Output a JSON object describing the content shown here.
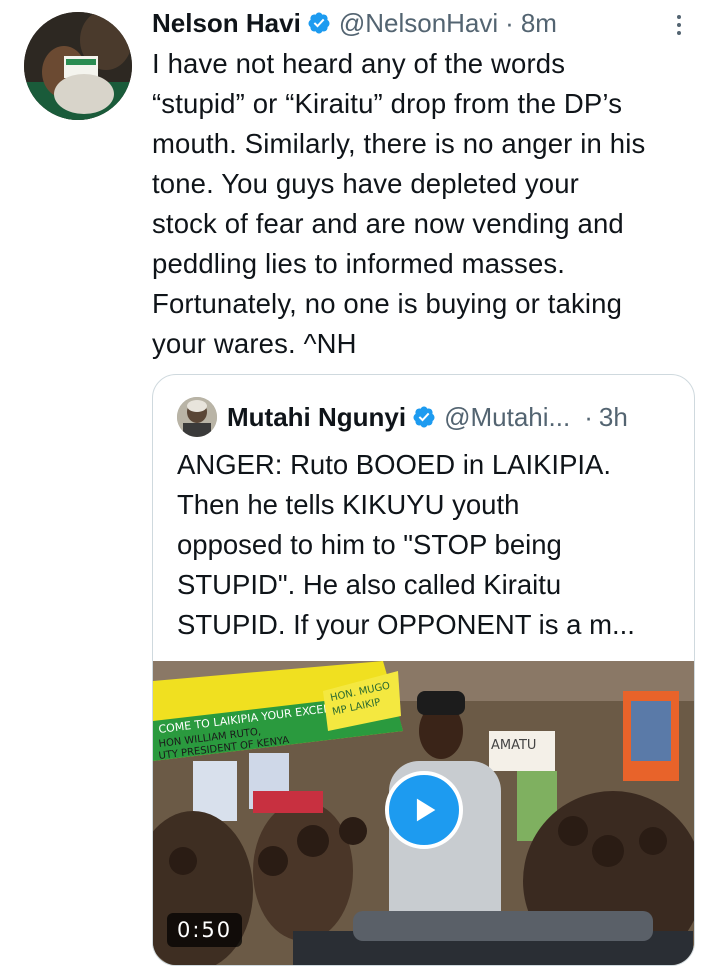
{
  "tweet": {
    "author_name": "Nelson Havi",
    "handle": "@NelsonHavi",
    "separator": "·",
    "time": "8m",
    "text_lines": [
      "I have not heard any of the words",
      "“stupid” or “Kiraitu” drop from the DP’s",
      "mouth. Similarly, there is no anger in his",
      "tone. You guys have depleted your",
      "stock of fear and are now vending and",
      "peddling lies to informed masses.",
      "Fortunately, no one is buying or taking",
      "your wares. ^NH"
    ]
  },
  "quoted": {
    "author_name": "Mutahi Ngunyi",
    "handle": "@Mutahi...",
    "separator": "·",
    "time": "3h",
    "text_lines": [
      "ANGER: Ruto BOOED in LAIKIPIA.",
      "Then he tells KIKUYU youth",
      "opposed to him to \"STOP being",
      "STUPID\". He also called Kiraitu",
      "STUPID. If your OPPONENT is a m..."
    ],
    "video": {
      "duration": "0:50",
      "banner_text": [
        "COME TO LAIKIPIA YOUR EXCELLENCY",
        "HON WILLIAM RUTO,",
        "UTY PRESIDENT OF KENYA",
        "HON. MUGO",
        "MP LAIKIP",
        "AMATU"
      ]
    }
  },
  "colors": {
    "text": "#0f1419",
    "secondary": "#536471",
    "verified": "#1d9bf0",
    "border": "#cfd9de"
  },
  "icons": [
    "verified-badge-icon",
    "more-options-icon",
    "play-icon"
  ]
}
